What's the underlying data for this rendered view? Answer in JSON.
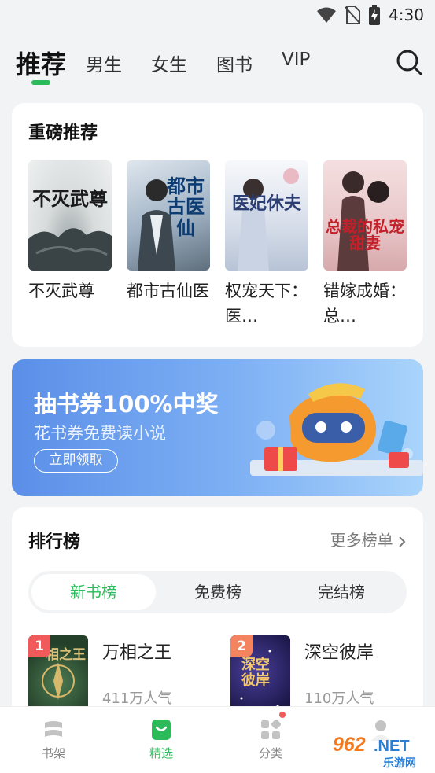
{
  "status_bar": {
    "time": "4:30"
  },
  "tabs": [
    {
      "label": "推荐",
      "active": true
    },
    {
      "label": "男生"
    },
    {
      "label": "女生"
    },
    {
      "label": "图书"
    },
    {
      "label": "VIP"
    }
  ],
  "featured": {
    "title": "重磅推荐",
    "books": [
      {
        "title": "不灭武尊",
        "cover_text": "不灭武尊"
      },
      {
        "title": "都市古仙医",
        "cover_text": "都市古医仙"
      },
      {
        "title": "权宠天下：医…",
        "cover_text": "医妃休夫"
      },
      {
        "title": "错嫁成婚：总…",
        "cover_text": "总裁的私宠甜妻"
      }
    ]
  },
  "banner": {
    "title": "抽书券100%中奖",
    "subtitle": "花书券免费读小说",
    "button_label": "立即领取"
  },
  "ranking": {
    "title": "排行榜",
    "more_label": "更多榜单",
    "segments": [
      {
        "label": "新书榜",
        "active": true
      },
      {
        "label": "免费榜"
      },
      {
        "label": "完结榜"
      }
    ],
    "items": [
      {
        "rank": "1",
        "title": "万相之王",
        "popularity": "411万人气",
        "cover_text": "相之王"
      },
      {
        "rank": "2",
        "title": "深空彼岸",
        "popularity": "110万人气",
        "cover_text": "深空彼岸"
      }
    ]
  },
  "bottom_nav": [
    {
      "label": "书架",
      "icon": "bookshelf-icon"
    },
    {
      "label": "精选",
      "icon": "featured-icon",
      "active": true
    },
    {
      "label": "分类",
      "icon": "category-icon",
      "badge": true
    },
    {
      "label": "",
      "icon": "profile-icon"
    }
  ],
  "watermark": {
    "text": "962.NET",
    "subtext": "乐游网"
  },
  "colors": {
    "accent": "#2dba5a",
    "badge_red": "#f05a5a",
    "badge_orange": "#f4845f"
  }
}
